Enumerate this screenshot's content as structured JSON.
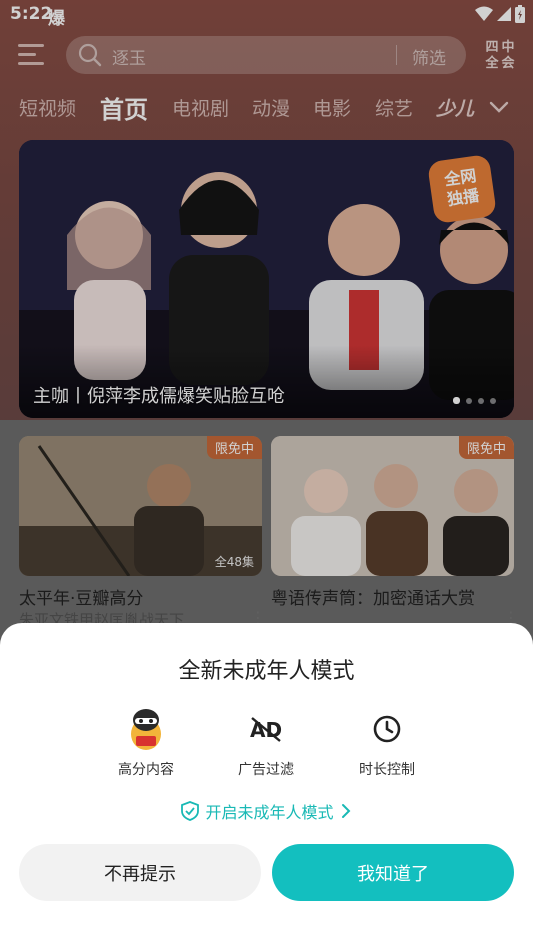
{
  "status_bar": {
    "time": "5:22",
    "extra": "爆"
  },
  "header": {
    "search_placeholder": "逐玉",
    "filter_label": "筛选",
    "logo_chars": [
      "四",
      "中",
      "全",
      "会"
    ]
  },
  "nav": {
    "tabs": [
      "短视频",
      "首页",
      "电视剧",
      "动漫",
      "电影",
      "综艺",
      "少儿"
    ],
    "active": "首页"
  },
  "banner": {
    "title": "主咖丨倪萍李成儒爆笑贴脸互呛",
    "corner_badge": "全网\n独播",
    "dots_count": 4
  },
  "cards": [
    {
      "badge": "限免中",
      "count": "全48集",
      "title": "太平年·豆瓣高分",
      "subtitle": "朱亚文铁甲赵匡胤战天下"
    },
    {
      "badge": "限免中",
      "count": "",
      "title": "粤语传声筒：加密通话大赏",
      "subtitle": ""
    }
  ],
  "teen_sheet": {
    "title": "全新未成年人模式",
    "features": [
      {
        "label": "高分内容",
        "icon": "mascot-icon"
      },
      {
        "label": "广告过滤",
        "icon": "no-ad-icon"
      },
      {
        "label": "时长控制",
        "icon": "clock-icon"
      }
    ],
    "enable_link": "开启未成年人模式",
    "dismiss_button": "不再提示",
    "ok_button": "我知道了"
  },
  "colors": {
    "accent": "#13bfbf",
    "link": "#19b9b5",
    "badge": "#c76a3a"
  }
}
